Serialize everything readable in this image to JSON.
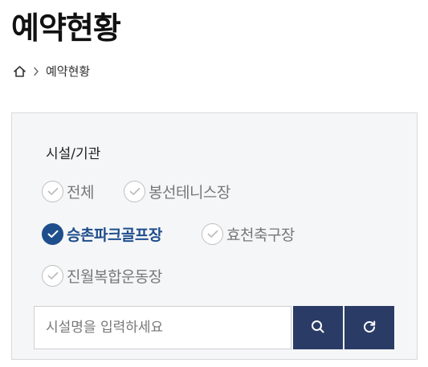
{
  "page": {
    "title": "예약현황"
  },
  "breadcrumb": {
    "home_icon": "home-icon",
    "separator_icon": "chevron-right-icon",
    "current": "예약현황"
  },
  "filter": {
    "group_label": "시설/기관",
    "options": [
      {
        "label": "전체",
        "checked": false
      },
      {
        "label": "봉선테니스장",
        "checked": false
      },
      {
        "label": "승촌파크골프장",
        "checked": true
      },
      {
        "label": "효천축구장",
        "checked": false
      },
      {
        "label": "진월복합운동장",
        "checked": false
      }
    ],
    "colors": {
      "accent": "#1f4e8c",
      "button": "#2a3c66",
      "panel_bg": "#f5f6f8"
    }
  },
  "search": {
    "placeholder": "시설명을 입력하세요",
    "value": "",
    "search_icon": "search-icon",
    "refresh_icon": "refresh-icon"
  }
}
